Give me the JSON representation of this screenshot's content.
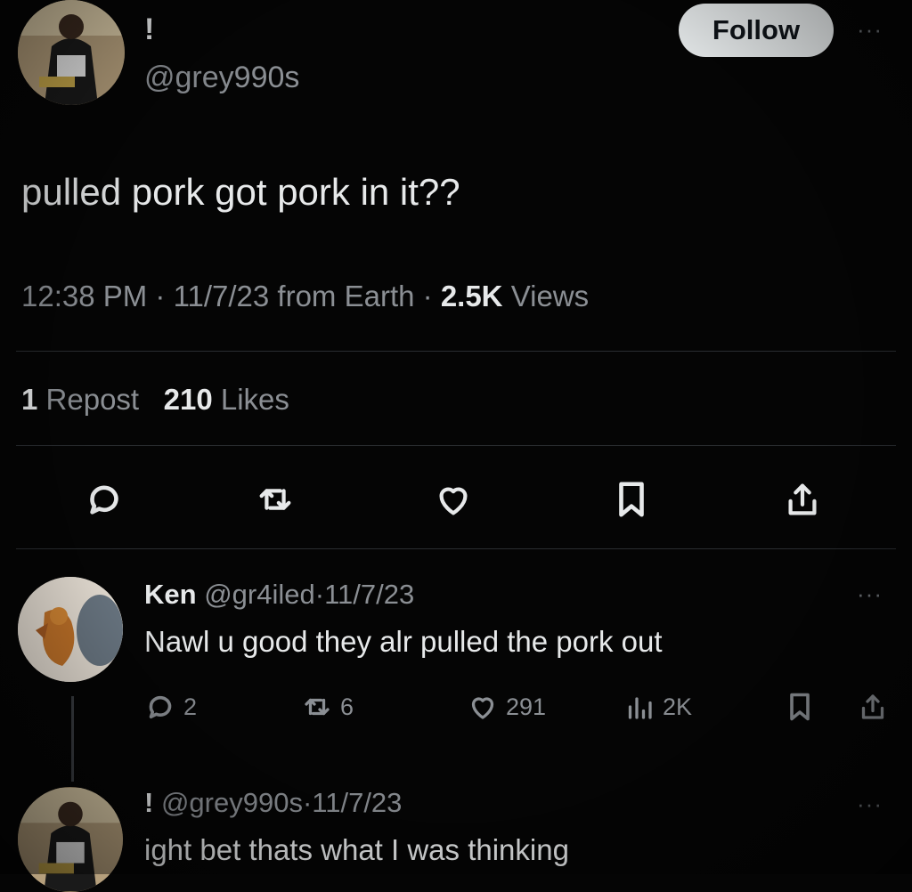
{
  "tweet": {
    "display_name": "!",
    "handle": "@grey990s",
    "follow_label": "Follow",
    "more_label": "···",
    "text": "pulled pork got pork in it??",
    "time": "12:38 PM",
    "sep": "·",
    "date": "11/7/23",
    "source": "from Earth",
    "views_count": "2.5K",
    "views_label": "Views",
    "repost_count": "1",
    "repost_label": "Repost",
    "likes_count": "210",
    "likes_label": "Likes",
    "actions": [
      "reply-icon",
      "repost-icon",
      "like-icon",
      "bookmark-icon",
      "share-icon"
    ]
  },
  "replies": [
    {
      "display_name": "Ken",
      "handle": "@gr4iled",
      "sep": "·",
      "date": "11/7/23",
      "more_label": "···",
      "text": "Nawl u good they alr pulled the pork out",
      "reply_count": "2",
      "repost_count": "6",
      "like_count": "291",
      "view_count": "2K"
    },
    {
      "display_name": "!",
      "handle": "@grey990s",
      "sep": "·",
      "date": "11/7/23",
      "more_label": "···",
      "text": "ight bet thats what I was thinking"
    }
  ]
}
